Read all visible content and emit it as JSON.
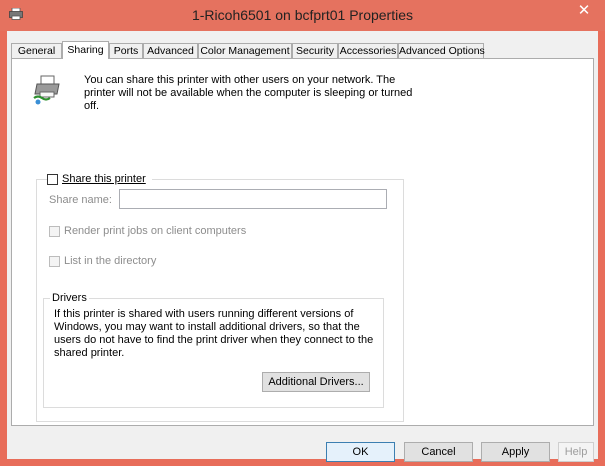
{
  "window": {
    "title": "1-Ricoh6501 on bcfprt01 Properties",
    "close_glyph": "✕",
    "accent": "#e5725f"
  },
  "tabs": [
    {
      "label": "General",
      "active": false
    },
    {
      "label": "Sharing",
      "active": true
    },
    {
      "label": "Ports",
      "active": false
    },
    {
      "label": "Advanced",
      "active": false
    },
    {
      "label": "Color Management",
      "active": false
    },
    {
      "label": "Security",
      "active": false
    },
    {
      "label": "Accessories",
      "active": false
    },
    {
      "label": "Advanced Options",
      "active": false
    }
  ],
  "sharing": {
    "intro": "You can share this printer with other users on your network. The printer will not be available when the computer is sleeping or turned off.",
    "share_label": "Share this printer",
    "share_checked": false,
    "share_name_label": "Share name:",
    "share_name_value": "",
    "render_label": "Render print jobs on client computers",
    "list_label": "List in the directory"
  },
  "drivers": {
    "title": "Drivers",
    "text": "If this printer is shared with users running different versions of Windows, you may want to install additional drivers, so that the users do not have to find the print driver when they connect to the shared printer.",
    "button": "Additional Drivers..."
  },
  "footer": {
    "ok": "OK",
    "cancel": "Cancel",
    "apply": "Apply",
    "help": "Help"
  }
}
